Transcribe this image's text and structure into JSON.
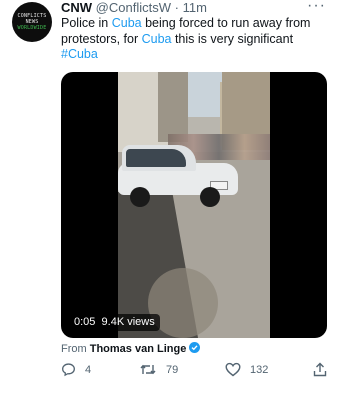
{
  "tweet": {
    "author_name": "CNW",
    "handle": "@ConflictsW",
    "separator": "·",
    "time": "11m",
    "more_icon": "more-horizontal-icon",
    "text_before_1": "Police in ",
    "keyword_1": "Cuba",
    "text_after_1": " being forced to run away from protestors, for ",
    "keyword_2": "Cuba",
    "text_after_2": " this is very significant",
    "hashtag": "#Cuba",
    "avatar_lines": [
      "CONFLICTS",
      "NEWS",
      "WORLDWIDE"
    ]
  },
  "video": {
    "duration": "0:05",
    "views": "9.4K views"
  },
  "attribution": {
    "prefix": "From",
    "name": "Thomas van Linge"
  },
  "actions": {
    "replies": "4",
    "retweets": "79",
    "likes": "132"
  },
  "colors": {
    "accent": "#1d9bf0",
    "text": "#0f1419",
    "secondary": "#536471"
  }
}
